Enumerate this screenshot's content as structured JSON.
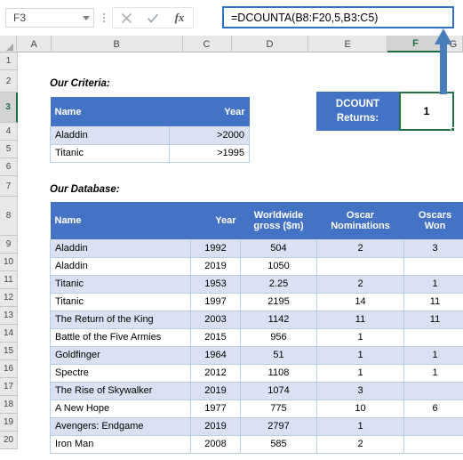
{
  "formula_bar": {
    "name_box_value": "F3",
    "formula": "=DCOUNTA(B8:F20,5,B3:C5)",
    "cancel_icon": "cancel-x-icon",
    "enter_icon": "check-icon",
    "function_icon": "fx"
  },
  "grid": {
    "column_headers": [
      "A",
      "B",
      "C",
      "D",
      "E",
      "F",
      "G"
    ],
    "selected_column": "F",
    "row_headers": [
      "1",
      "2",
      "3",
      "4",
      "5",
      "6",
      "7",
      "8",
      "9",
      "10",
      "11",
      "12",
      "13",
      "14",
      "15",
      "16",
      "17",
      "18",
      "19",
      "20"
    ],
    "selected_row": "3"
  },
  "criteria": {
    "caption": "Our Criteria:",
    "headers": [
      "Name",
      "Year"
    ],
    "rows": [
      {
        "name": "Aladdin",
        "year": ">2000"
      },
      {
        "name": "Titanic",
        "year": ">1995"
      }
    ]
  },
  "database": {
    "caption": "Our Database:",
    "headers": [
      "Name",
      "Year",
      "Worldwide gross ($m)",
      "Oscar Nominations",
      "Oscars Won"
    ],
    "header_lines": {
      "name": "Name",
      "year": "Year",
      "gross_line1": "Worldwide",
      "gross_line2": "gross ($m)",
      "nominations_line1": "Oscar",
      "nominations_line2": "Nominations",
      "won_line1": "Oscars",
      "won_line2": "Won"
    },
    "rows": [
      {
        "name": "Aladdin",
        "year": "1992",
        "gross": "504",
        "nominations": "2",
        "won": "3"
      },
      {
        "name": "Aladdin",
        "year": "2019",
        "gross": "1050",
        "nominations": "",
        "won": ""
      },
      {
        "name": "Titanic",
        "year": "1953",
        "gross": "2.25",
        "nominations": "2",
        "won": "1"
      },
      {
        "name": "Titanic",
        "year": "1997",
        "gross": "2195",
        "nominations": "14",
        "won": "11"
      },
      {
        "name": "The Return of the King",
        "year": "2003",
        "gross": "1142",
        "nominations": "11",
        "won": "11"
      },
      {
        "name": "Battle of the Five Armies",
        "year": "2015",
        "gross": "956",
        "nominations": "1",
        "won": ""
      },
      {
        "name": "Goldfinger",
        "year": "1964",
        "gross": "51",
        "nominations": "1",
        "won": "1"
      },
      {
        "name": "Spectre",
        "year": "2012",
        "gross": "1108",
        "nominations": "1",
        "won": "1"
      },
      {
        "name": "The Rise of Skywalker",
        "year": "2019",
        "gross": "1074",
        "nominations": "3",
        "won": ""
      },
      {
        "name": "A New Hope",
        "year": "1977",
        "gross": "775",
        "nominations": "10",
        "won": "6"
      },
      {
        "name": "Avengers: Endgame",
        "year": "2019",
        "gross": "2797",
        "nominations": "1",
        "won": ""
      },
      {
        "name": "Iron Man",
        "year": "2008",
        "gross": "585",
        "nominations": "2",
        "won": ""
      }
    ]
  },
  "callout": {
    "label_line1": "DCOUNT",
    "label_line2": "Returns:",
    "value": "1",
    "arrow_icon": "up-arrow-icon"
  },
  "colors": {
    "header_blue": "#4472c4",
    "band_blue": "#d9e1f2",
    "border_blue": "#b8cce4",
    "selection_green": "#217346",
    "formula_border": "#2f6fc4",
    "arrow_blue": "#4a7ebb"
  }
}
